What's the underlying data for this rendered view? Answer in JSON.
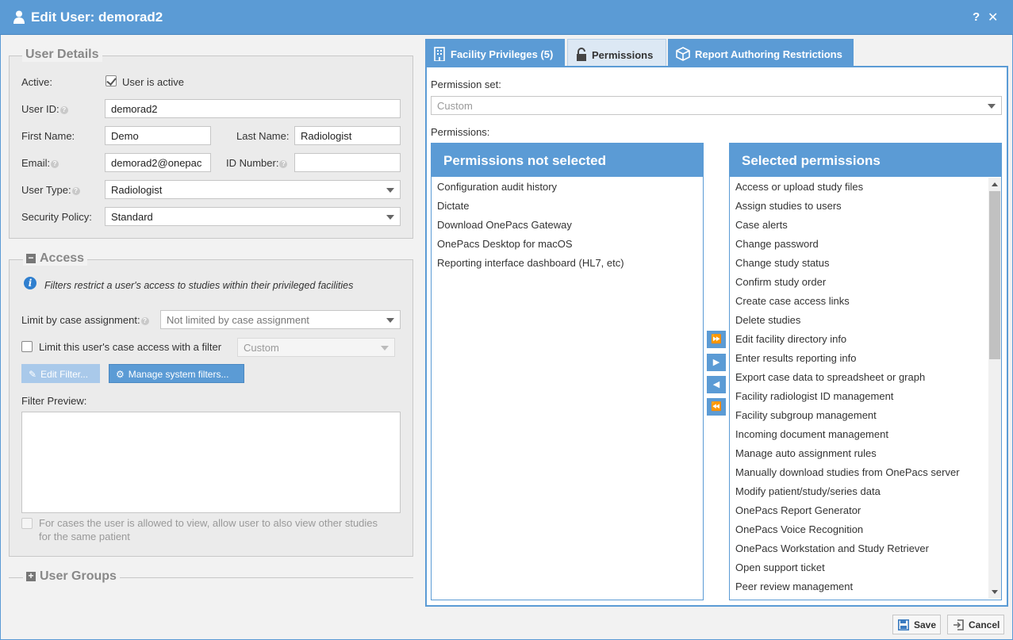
{
  "window": {
    "title": "Edit User: demorad2",
    "help_label": "?",
    "close_label": "✕"
  },
  "user_details": {
    "legend": "User Details",
    "active_label": "Active:",
    "active_checkbox_label": "User is active",
    "user_id_label": "User ID:",
    "user_id_value": "demorad2",
    "first_name_label": "First Name:",
    "first_name_value": "Demo",
    "last_name_label": "Last Name:",
    "last_name_value": "Radiologist",
    "email_label": "Email:",
    "email_value": "demorad2@onepac",
    "id_number_label": "ID Number:",
    "id_number_value": "",
    "user_type_label": "User Type:",
    "user_type_value": "Radiologist",
    "security_policy_label": "Security Policy:",
    "security_policy_value": "Standard"
  },
  "access": {
    "legend": "Access",
    "info_text": "Filters restrict a user's access to studies within their privileged facilities",
    "limit_case_label": "Limit by case assignment:",
    "limit_case_value": "Not limited by case assignment",
    "limit_filter_label": "Limit this user's case access with a filter",
    "limit_filter_value": "Custom",
    "edit_filter_label": "Edit Filter...",
    "manage_filters_label": "Manage system filters...",
    "filter_preview_label": "Filter Preview:",
    "other_studies_line1": "For cases the user is allowed to view, allow user to also view other studies",
    "other_studies_line2": "for the same patient"
  },
  "user_groups": {
    "legend": "User Groups"
  },
  "tabs": {
    "facility": "Facility Privileges (5)",
    "permissions": "Permissions",
    "report": "Report Authoring Restrictions"
  },
  "permissions_panel": {
    "permission_set_label": "Permission set:",
    "permission_set_value": "Custom",
    "permissions_label": "Permissions:",
    "not_selected_header": "Permissions not selected",
    "selected_header": "Selected permissions",
    "not_selected": [
      "Configuration audit history",
      "Dictate",
      "Download OnePacs Gateway",
      "OnePacs Desktop for macOS",
      "Reporting interface dashboard (HL7, etc)"
    ],
    "selected": [
      "Access or upload study files",
      "Assign studies to users",
      "Case alerts",
      "Change password",
      "Change study status",
      "Confirm study order",
      "Create case access links",
      "Delete studies",
      "Edit facility directory info",
      "Enter results reporting info",
      "Export case data to spreadsheet or graph",
      "Facility radiologist ID management",
      "Facility subgroup management",
      "Incoming document management",
      "Manage auto assignment rules",
      "Manually download studies from OnePacs server",
      "Modify patient/study/series data",
      "OnePacs Report Generator",
      "OnePacs Voice Recognition",
      "OnePacs Workstation and Study Retriever",
      "Open support ticket",
      "Peer review management"
    ],
    "move_buttons": [
      "⏩",
      "▶",
      "◀",
      "⏪"
    ]
  },
  "footer": {
    "save_label": "Save",
    "cancel_label": "Cancel"
  },
  "colors": {
    "accent": "#5b9bd5",
    "info": "#2f7fcf"
  }
}
